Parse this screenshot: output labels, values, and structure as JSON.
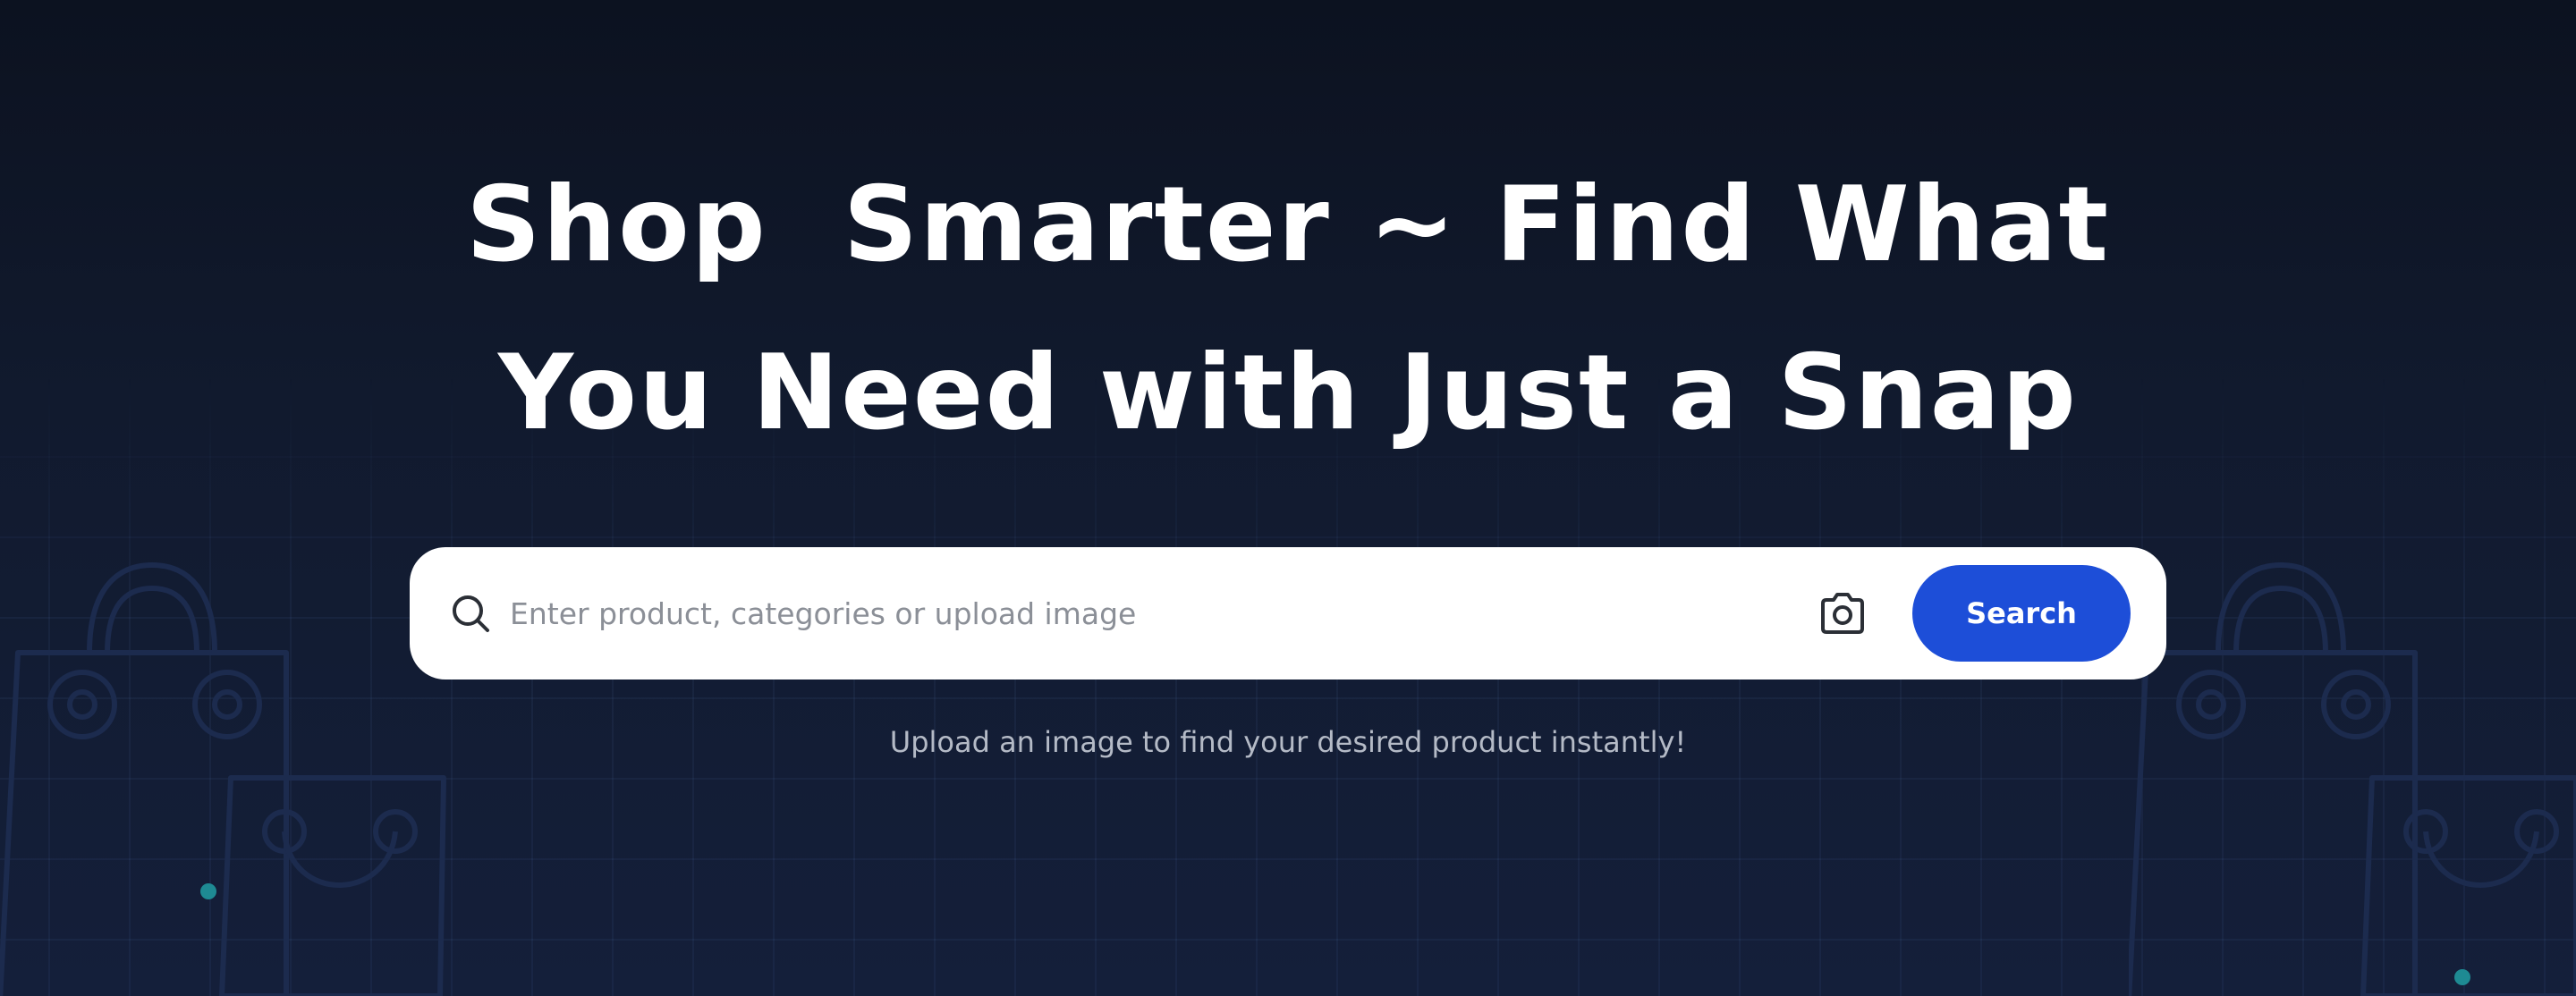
{
  "hero": {
    "headline_line1": "Shop  Smarter ~ Find What",
    "headline_line2": "You Need with Just a Snap",
    "subtitle": "Upload an image to find your desired product instantly!"
  },
  "search": {
    "placeholder": "Enter product, categories or upload image",
    "value": "",
    "button_label": "Search",
    "icons": {
      "search": "search-icon",
      "camera": "camera-icon"
    }
  },
  "colors": {
    "background": "#111a2e",
    "headline": "#ffffff",
    "search_bar": "#ffffff",
    "accent": "#1d4ed8",
    "subtitle": "#b4bac6",
    "dot": "#1e8a93",
    "decor_outline": "#1e2d52"
  }
}
